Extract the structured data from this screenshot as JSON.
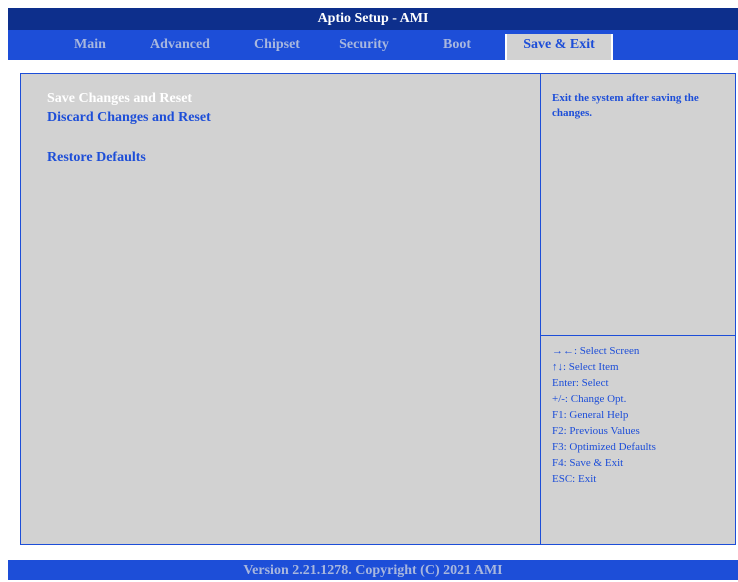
{
  "title": "Aptio Setup - AMI",
  "tabs": [
    {
      "label": "Main"
    },
    {
      "label": "Advanced"
    },
    {
      "label": "Chipset"
    },
    {
      "label": "Security"
    },
    {
      "label": "Boot"
    },
    {
      "label": "Save & Exit"
    }
  ],
  "active_tab": "Save & Exit",
  "menu": {
    "items": [
      {
        "label": "Save Changes and Reset",
        "selected": true
      },
      {
        "label": "Discard Changes and Reset",
        "selected": false
      },
      {
        "label": "Restore Defaults",
        "selected": false
      }
    ]
  },
  "help": {
    "text": "Exit the system after saving the changes."
  },
  "keys": [
    "→←: Select Screen",
    "↑↓: Select Item",
    "Enter: Select",
    "+/-: Change Opt.",
    "F1: General Help",
    "F2: Previous Values",
    "F3: Optimized Defaults",
    "F4: Save & Exit",
    "ESC: Exit"
  ],
  "footer": "Version 2.21.1278. Copyright (C) 2021 AMI",
  "colors": {
    "title_bg": "#0d2f8c",
    "tab_bar_bg": "#1d4ed8",
    "panel_bg": "#d2d2d2",
    "text_blue": "#1d4ed8",
    "selected_text": "#ffffff",
    "inactive_tab_text": "#a8b7de"
  }
}
